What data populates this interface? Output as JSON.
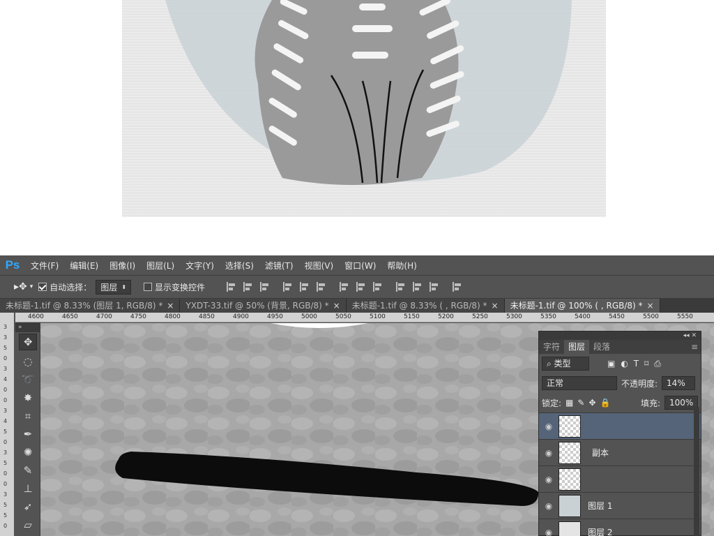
{
  "menu": {
    "logo": "Ps",
    "items": [
      "文件(F)",
      "编辑(E)",
      "图像(I)",
      "图层(L)",
      "文字(Y)",
      "选择(S)",
      "滤镜(T)",
      "视图(V)",
      "窗口(W)",
      "帮助(H)"
    ]
  },
  "options": {
    "auto_select_label": "自动选择：",
    "auto_select_value": "图层",
    "show_transform_label": "显示变换控件"
  },
  "tabs": [
    {
      "label": "未标题-1.tif @ 8.33% (图层 1, RGB/8) *",
      "close": "×"
    },
    {
      "label": "YXDT-33.tif @ 50% (背景, RGB/8) *",
      "close": "×"
    },
    {
      "label": "未标题-1.tif @ 8.33% ( , RGB/8) *",
      "close": "×"
    },
    {
      "label": "未标题-1.tif @ 100% ( , RGB/8) *",
      "close": "×"
    }
  ],
  "ruler": [
    "4600",
    "4650",
    "4700",
    "4750",
    "4800",
    "4850",
    "4900",
    "4950",
    "5000",
    "5050",
    "5100",
    "5150",
    "5200",
    "5250",
    "5300",
    "5350",
    "5400",
    "5450",
    "5500",
    "5550"
  ],
  "vruler": [
    "3",
    "3",
    "5",
    "0",
    "3",
    "4",
    "0",
    "0",
    "3",
    "4",
    "5",
    "0",
    "3",
    "5",
    "0",
    "0",
    "3",
    "5",
    "5",
    "0"
  ],
  "layers_panel": {
    "tabs": [
      "字符",
      "图层",
      "段落"
    ],
    "filter_label": "类型",
    "blend_mode": "正常",
    "opacity_label": "不透明度:",
    "opacity_value": "14%",
    "lock_label": "锁定:",
    "fill_label": "填充:",
    "fill_value": "100%",
    "layers": [
      {
        "name": "",
        "active": true,
        "thumb": "checker"
      },
      {
        "name": "副本",
        "active": false,
        "thumb": "checker"
      },
      {
        "name": "",
        "active": false,
        "thumb": "checker"
      },
      {
        "name": "图层 1",
        "active": false,
        "thumb": "solid1"
      },
      {
        "name": "图层 2",
        "active": false,
        "thumb": "solid2"
      }
    ]
  },
  "toolbox_header": "»",
  "colors": {
    "ps_bg": "#535353",
    "accent": "#31a8ff",
    "selected_layer": "#566479"
  }
}
